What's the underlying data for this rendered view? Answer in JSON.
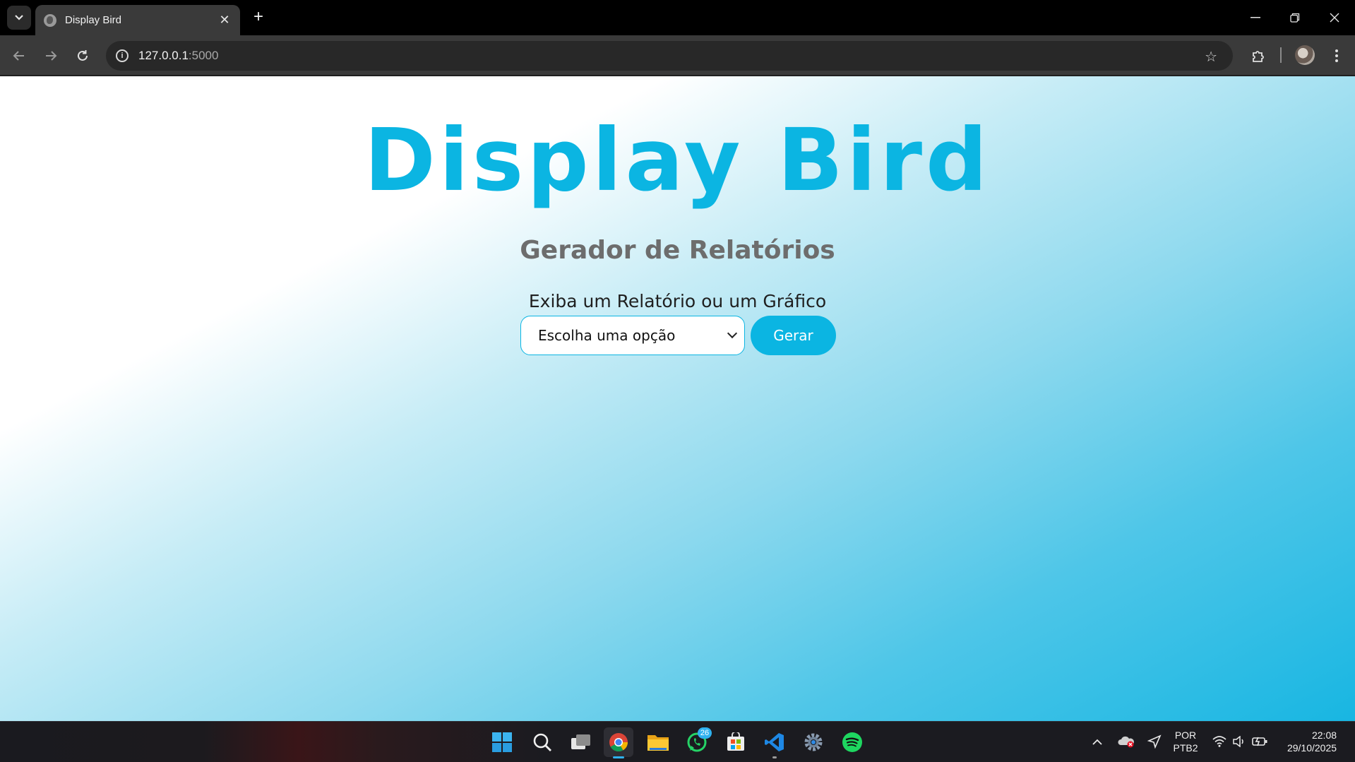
{
  "browser": {
    "tab_title": "Display Bird",
    "url_host": "127.0.0.1",
    "url_port": ":5000"
  },
  "page": {
    "brand": "Display Bird",
    "subtitle": "Gerador de Relatórios",
    "prompt": "Exiba um Relatório ou um Gráfico",
    "select_value": "Escolha uma opção",
    "button_label": "Gerar"
  },
  "taskbar": {
    "whatsapp_badge": "26",
    "language_line1": "POR",
    "language_line2": "PTB2",
    "time": "22:08",
    "date": "29/10/2025"
  },
  "colors": {
    "accent": "#0bb5e2",
    "subtitle": "#6d6d6d"
  },
  "icons": [
    "tab-search-icon",
    "globe-favicon-icon",
    "close-icon",
    "plus-icon",
    "minimize-icon",
    "restore-icon",
    "back-icon",
    "forward-icon",
    "reload-icon",
    "info-icon",
    "star-icon",
    "extensions-icon",
    "avatar",
    "kebab-menu-icon",
    "windows-start-icon",
    "search-icon",
    "task-view-icon",
    "chrome-icon",
    "file-explorer-icon",
    "whatsapp-icon",
    "ms-store-icon",
    "vscode-icon",
    "settings-icon",
    "spotify-icon",
    "chevron-up-icon",
    "onedrive-icon",
    "location-icon",
    "wifi-icon",
    "volume-icon",
    "battery-icon"
  ]
}
